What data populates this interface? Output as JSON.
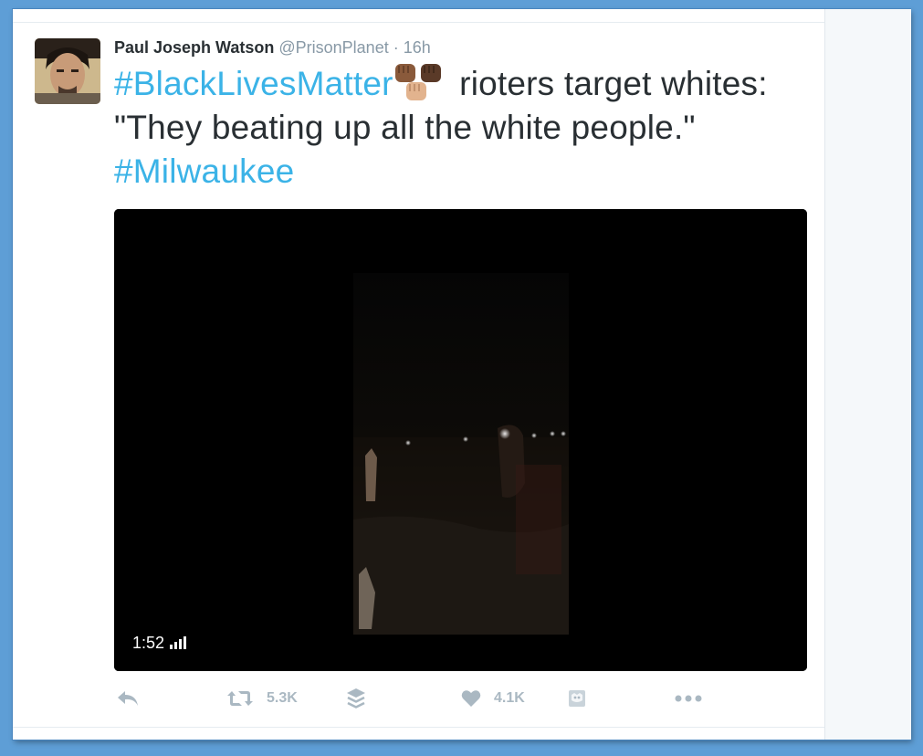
{
  "tweet": {
    "author_name": "Paul Joseph Watson",
    "handle": "@PrisonPlanet",
    "separator": "·",
    "time": "16h",
    "text": {
      "hashtag1": "#BlackLivesMatter",
      "emoji": [
        "raised-fist-medium-dark",
        "raised-fist-dark",
        "raised-fist-medium-light"
      ],
      "line1_rest": " rioters target whites:",
      "line2": "\"They beating up all the white people.\"",
      "hashtag2": "#Milwaukee"
    },
    "media": {
      "type": "video",
      "duration": "1:52"
    },
    "actions": {
      "retweet_count": "5.3K",
      "like_count": "4.1K"
    }
  },
  "colors": {
    "link": "#3bb3e7",
    "text": "#292f33",
    "muted": "#8899a6",
    "action_icons": "#aab8c2",
    "frame": "#5e9ed6"
  },
  "icons": [
    "reply-icon",
    "retweet-icon",
    "stack-icon",
    "heart-icon",
    "gif-media-icon",
    "more-icon",
    "signal-bars-icon"
  ]
}
